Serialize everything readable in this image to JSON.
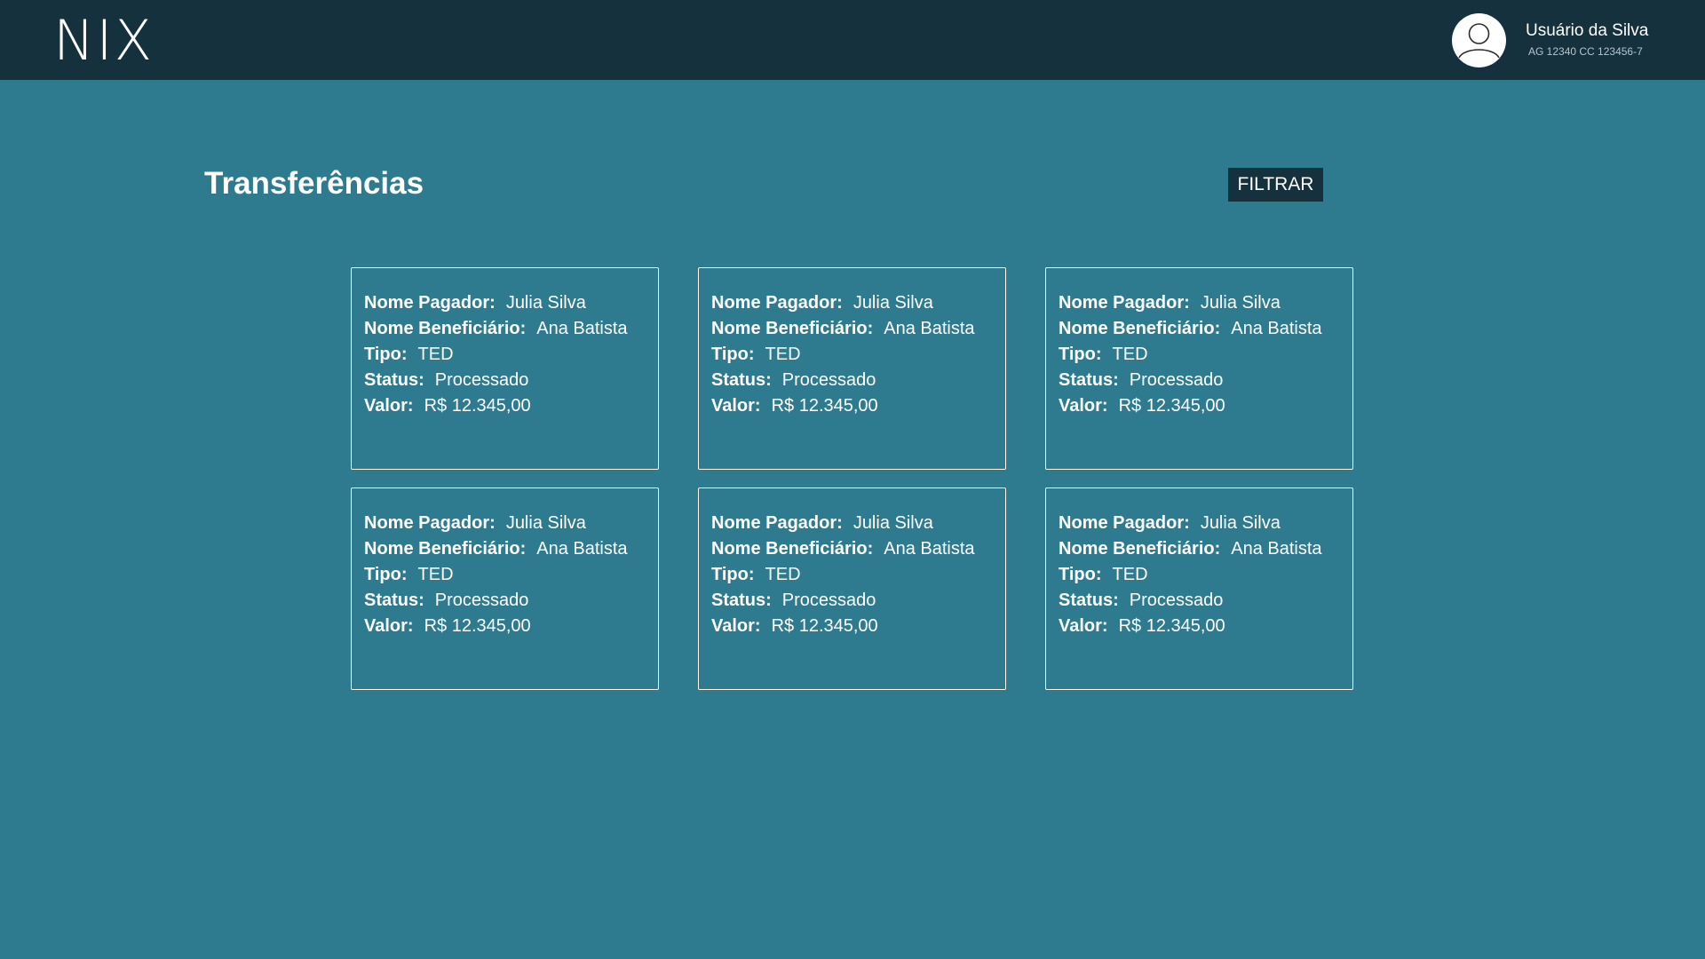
{
  "header": {
    "logo": "NIX",
    "user": {
      "name": "Usuário da Silva",
      "account": "AG 12340 CC 123456-7",
      "avatar_icon": "user-avatar-icon"
    }
  },
  "main": {
    "title": "Transferências",
    "filter_label": "FILTRAR",
    "field_labels": {
      "payer": "Nome Pagador:",
      "beneficiary": "Nome Beneficiário:",
      "type": "Tipo:",
      "status": "Status:",
      "value": "Valor:"
    },
    "transfers": [
      {
        "payer": "Julia Silva",
        "beneficiary": "Ana Batista",
        "type": "TED",
        "status": "Processado",
        "value": "R$ 12.345,00"
      },
      {
        "payer": "Julia Silva",
        "beneficiary": "Ana Batista",
        "type": "TED",
        "status": "Processado",
        "value": "R$ 12.345,00"
      },
      {
        "payer": "Julia Silva",
        "beneficiary": "Ana Batista",
        "type": "TED",
        "status": "Processado",
        "value": "R$ 12.345,00"
      },
      {
        "payer": "Julia Silva",
        "beneficiary": "Ana Batista",
        "type": "TED",
        "status": "Processado",
        "value": "R$ 12.345,00"
      },
      {
        "payer": "Julia Silva",
        "beneficiary": "Ana Batista",
        "type": "TED",
        "status": "Processado",
        "value": "R$ 12.345,00"
      },
      {
        "payer": "Julia Silva",
        "beneficiary": "Ana Batista",
        "type": "TED",
        "status": "Processado",
        "value": "R$ 12.345,00"
      }
    ]
  },
  "colors": {
    "background": "#2e7a8f",
    "header": "#14313d",
    "button": "#14313d",
    "text": "#ffffff"
  }
}
